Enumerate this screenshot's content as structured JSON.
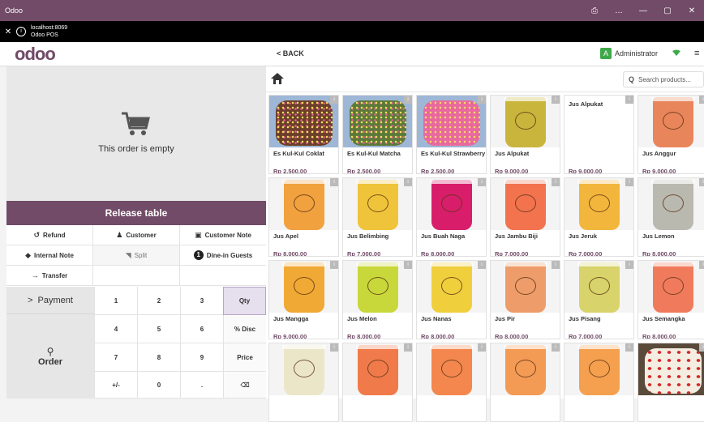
{
  "window": {
    "title": "Odoo",
    "controls": [
      "⎙",
      "…",
      "—",
      "▢",
      "✕"
    ]
  },
  "url": {
    "host": "localhost:8069",
    "page": "Odoo POS"
  },
  "nav": {
    "logo": "odoo",
    "back_label": "BACK",
    "user_initial": "A",
    "user_name": "Administrator"
  },
  "order": {
    "empty_text": "This order is empty",
    "release_label": "Release table"
  },
  "actions": {
    "refund": "Refund",
    "customer": "Customer",
    "customer_note": "Customer Note",
    "internal_note": "Internal Note",
    "split": "Split",
    "guests_count": "1",
    "guests": "Dine-in Guests",
    "transfer": "Transfer"
  },
  "pad": {
    "payment": "Payment",
    "order": "Order",
    "keys": [
      "1",
      "2",
      "3",
      "Qty",
      "4",
      "5",
      "6",
      "% Disc",
      "7",
      "8",
      "9",
      "Price",
      "+/-",
      "0",
      ".",
      "⌫"
    ]
  },
  "search": {
    "placeholder": "Search products..."
  },
  "products": [
    {
      "name": "Es Kul-Kul Coklat",
      "price": "Rp 2,500.00",
      "kind": "pop",
      "color": "#6b3f2a"
    },
    {
      "name": "Es Kul-Kul Matcha",
      "price": "Rp 2,500.00",
      "kind": "pop",
      "color": "#5b7a3a"
    },
    {
      "name": "Es Kul-Kul Strawberry",
      "price": "Rp 2,500.00",
      "kind": "pop",
      "color": "#e86aa0"
    },
    {
      "name": "Jus Alpukat",
      "price": "Rp 9,000.00",
      "kind": "cup",
      "color": "#c9b53c"
    },
    {
      "name": "Jus Alpukat",
      "price": "Rp 9,000.00",
      "kind": "none",
      "color": "#ffffff"
    },
    {
      "name": "Jus Anggur",
      "price": "Rp 9,000.00",
      "kind": "cup",
      "color": "#e9855a"
    },
    {
      "name": "Jus Apel",
      "price": "Rp 8,000.00",
      "kind": "cup",
      "color": "#f1a13e"
    },
    {
      "name": "Jus Belimbing",
      "price": "Rp 7,000.00",
      "kind": "cup",
      "color": "#f0c43a"
    },
    {
      "name": "Jus Buah Naga",
      "price": "Rp 8,000.00",
      "kind": "cup",
      "color": "#d81e6a"
    },
    {
      "name": "Jus Jambu Biji",
      "price": "Rp 7,000.00",
      "kind": "cup",
      "color": "#f2734e"
    },
    {
      "name": "Jus Jeruk",
      "price": "Rp 7,000.00",
      "kind": "cup",
      "color": "#f3b63c"
    },
    {
      "name": "Jus Lemon",
      "price": "Rp 8,000.00",
      "kind": "cup",
      "color": "#b9b9b0"
    },
    {
      "name": "Jus Mangga",
      "price": "Rp 9,000.00",
      "kind": "cup",
      "color": "#f1a935"
    },
    {
      "name": "Jus Melon",
      "price": "Rp 8,000.00",
      "kind": "cup",
      "color": "#c8d83a"
    },
    {
      "name": "Jus Nanas",
      "price": "Rp 8,000.00",
      "kind": "cup",
      "color": "#f0cf3d"
    },
    {
      "name": "Jus Pir",
      "price": "Rp 8,000.00",
      "kind": "cup",
      "color": "#ee9d6a"
    },
    {
      "name": "Jus Pisang",
      "price": "Rp 7,000.00",
      "kind": "cup",
      "color": "#d8d36a"
    },
    {
      "name": "Jus Semangka",
      "price": "Rp 8,000.00",
      "kind": "cup",
      "color": "#f07b5c"
    },
    {
      "name": "",
      "price": "",
      "kind": "cup",
      "color": "#ece6c9"
    },
    {
      "name": "",
      "price": "",
      "kind": "cup",
      "color": "#f07a4a"
    },
    {
      "name": "",
      "price": "",
      "kind": "cup",
      "color": "#f4874e"
    },
    {
      "name": "",
      "price": "",
      "kind": "cup",
      "color": "#f39a55"
    },
    {
      "name": "",
      "price": "",
      "kind": "cup",
      "color": "#f4a04e"
    },
    {
      "name": "",
      "price": "",
      "kind": "cake",
      "color": "#e8d9c5"
    }
  ]
}
